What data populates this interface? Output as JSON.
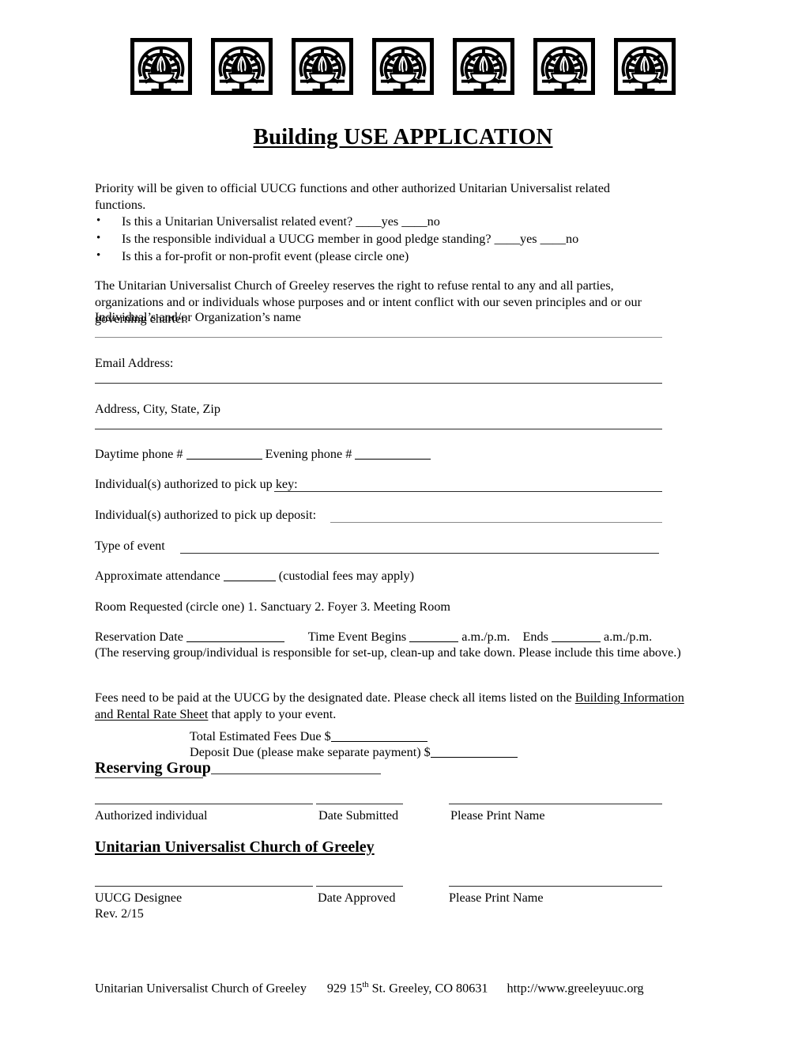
{
  "document": {
    "title": "Building USE APPLICATION",
    "icon_name": "uu-flaming-chalice-icon",
    "icon_count": 7
  },
  "intro": {
    "priority_note": "Priority will be given to official UUCG functions and other authorized Unitarian Universalist related functions.",
    "bullets": [
      "Is this a Unitarian Universalist related event? ____yes ____no",
      "Is the responsible individual a UUCG member in good pledge standing?  ____yes ____no",
      "Is this a for-profit or non-profit event (please circle one)"
    ],
    "disclaimer": "The Unitarian Universalist Church of Greeley reserves the right to refuse rental to any and all parties, organizations and or individuals whose purposes and or intent conflict with our seven principles and or our governing charter."
  },
  "fields": {
    "name_label": "Individual’s and/or Organization’s name",
    "email_label": "Email Address:",
    "address_label": "Address, City, State, Zip",
    "daytime_phone_label": "Daytime phone #",
    "evening_phone_label": "Evening phone #",
    "key_label": "Individual(s) authorized to pick up key:",
    "deposit_label": "Individual(s) authorized to pick up deposit:",
    "event_type_label": "Type of event",
    "attendance_label": "Approximate attendance",
    "attendance_suffix": "(custodial fees may apply)",
    "room_label": "Room Requested  (circle one)   1.  Sanctuary    2.  Foyer    3.  Meeting Room",
    "reservation_date_label": "Reservation Date",
    "time_begins_label": "Time Event Begins",
    "time_begins_suffix": "a.m./p.m.",
    "time_ends_label": "Ends",
    "time_ends_suffix": "a.m./p.m.",
    "setup_note": "(The reserving group/individual is responsible for set-up, clean-up and take down. Please include this time above.)"
  },
  "fees": {
    "note_part1": "Fees need to be paid at the UUCG by the designated date.  Please check all items listed on the ",
    "note_link_line1": "Building Information",
    "note_link_line2": "and Rental Rate Sheet",
    "note_part2": " that apply to your event.",
    "total_label": "Total Estimated Fees Due  $",
    "deposit_label": "Deposit Due (please make separate payment)  $",
    "reserving_group_label": "Reserving Group"
  },
  "signatures": {
    "applicant": {
      "field1": "Authorized individual",
      "field2": "Date Submitted",
      "field3": "Please Print Name"
    },
    "church_heading": "Unitarian Universalist Church of Greeley",
    "designee": {
      "field1": "UUCG Designee",
      "field2": "Date Approved",
      "field3": "Please Print Name"
    },
    "revision": "Rev. 2/15"
  },
  "footer": {
    "org": "Unitarian Universalist Church of Greeley",
    "address_number": "929 15",
    "address_ordinal": "th",
    "address_rest": " St. Greeley, CO  80631",
    "website": "http://www.greeleyuuc.org"
  }
}
